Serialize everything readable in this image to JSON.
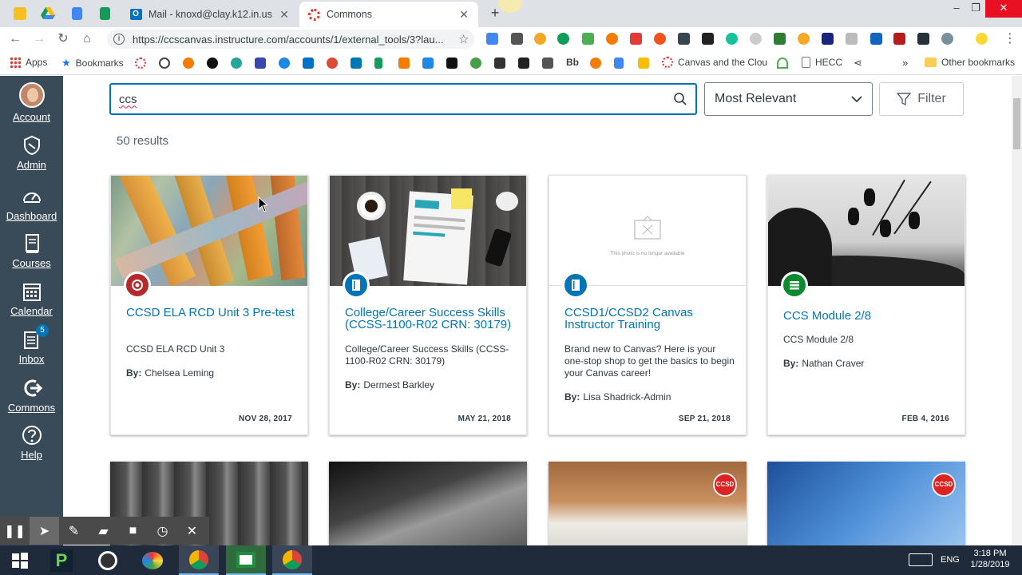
{
  "browser": {
    "tabs": [
      {
        "title": "Mail - knoxd@clay.k12.in.us",
        "active": false
      },
      {
        "title": "Commons",
        "active": true
      }
    ],
    "url": "https://ccscanvas.instructure.com/accounts/1/external_tools/3?lau...",
    "bookmarks": {
      "apps": "Apps",
      "bookmarks": "Bookmarks",
      "bb": "Bb",
      "canvas_cloud": "Canvas and the Clou",
      "hecc": "HECC",
      "more": "»",
      "other": "Other bookmarks"
    },
    "window": {
      "minimize": "–",
      "restore": "❐",
      "close": "✕"
    }
  },
  "global_nav": [
    {
      "label": "Account",
      "icon": "avatar"
    },
    {
      "label": "Admin",
      "icon": "shield-icon"
    },
    {
      "label": "Dashboard",
      "icon": "dashboard-icon"
    },
    {
      "label": "Courses",
      "icon": "book-icon"
    },
    {
      "label": "Calendar",
      "icon": "calendar-icon"
    },
    {
      "label": "Inbox",
      "icon": "inbox-icon",
      "badge": "5"
    },
    {
      "label": "Commons",
      "icon": "commons-icon"
    },
    {
      "label": "Help",
      "icon": "help-icon"
    }
  ],
  "search": {
    "value": "ccs"
  },
  "sort": {
    "selected": "Most Relevant"
  },
  "filter": {
    "label": "Filter"
  },
  "results": {
    "count_label": "50 results"
  },
  "cards": [
    {
      "title": "CCSD ELA RCD Unit 3 Pre-test",
      "description": "CCSD ELA RCD Unit 3",
      "by_label": "By:",
      "author": "Chelsea Leming",
      "date": "NOV 28, 2017",
      "type_color": "#b42a2a",
      "type_icon": "quiz-icon"
    },
    {
      "title": "College/Career Success Skills (CCSS-1100-R02 CRN: 30179)",
      "description": "College/Career Success Skills (CCSS-1100-R02 CRN: 30179)",
      "by_label": "By:",
      "author": "Dermest Barkley",
      "date": "MAY 21, 2018",
      "type_color": "#0374b5",
      "type_icon": "course-icon"
    },
    {
      "title": "CCSD1/CCSD2 Canvas Instructor Training",
      "description": "Brand new to Canvas? Here is your one-stop shop to get the basics to begin your Canvas career!",
      "by_label": "By:",
      "author": "Lisa Shadrick-Admin",
      "date": "SEP 21, 2018",
      "type_color": "#0374b5",
      "type_icon": "course-icon",
      "image_missing_text": "This photo is no longer available"
    },
    {
      "title": "CCS Module 2/8",
      "description": "CCS Module 2/8",
      "by_label": "By:",
      "author": "Nathan Craver",
      "date": "FEB 4, 2016",
      "type_color": "#0b8a2e",
      "type_icon": "module-icon"
    }
  ],
  "second_row_logo": "CCSD",
  "taskbar": {
    "lang": "ENG",
    "time": "3:18 PM",
    "date": "1/28/2019"
  }
}
